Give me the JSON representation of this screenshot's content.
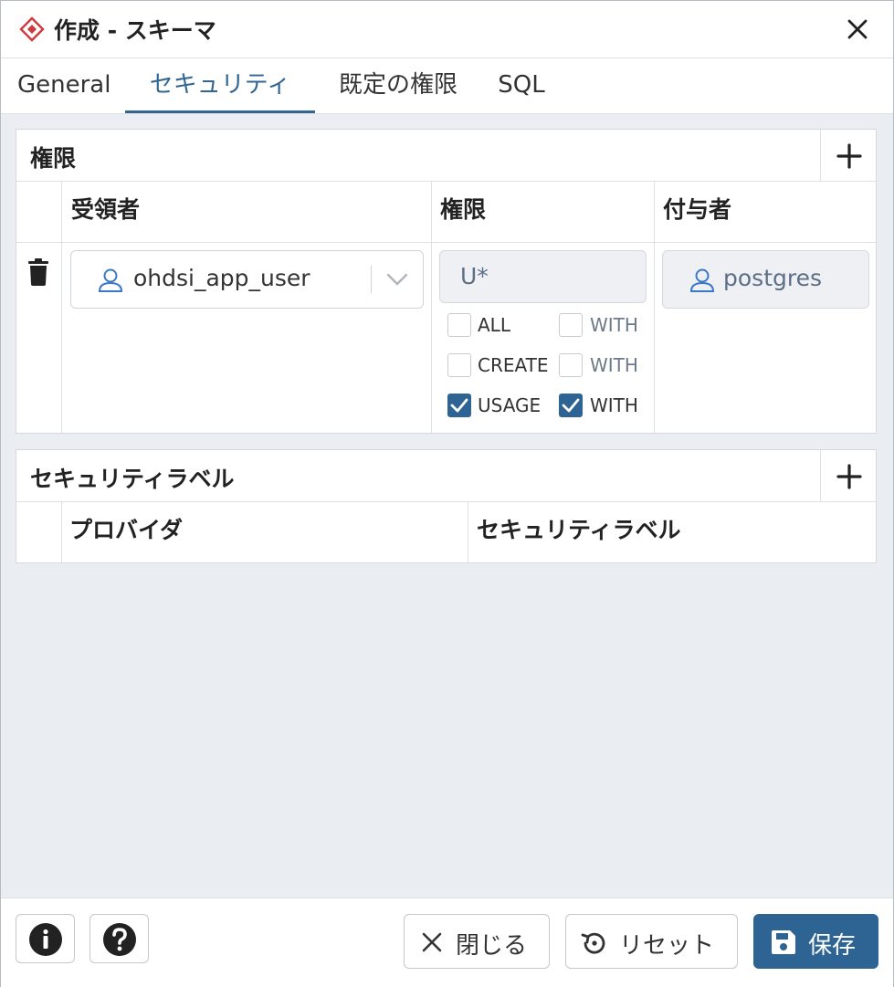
{
  "dialog": {
    "title": "作成 - スキーマ"
  },
  "tabs": [
    {
      "label": "General",
      "active": false
    },
    {
      "label": "セキュリティ",
      "active": true
    },
    {
      "label": "既定の権限",
      "active": false
    },
    {
      "label": "SQL",
      "active": false
    }
  ],
  "privileges_panel": {
    "title": "権限",
    "columns": [
      "受領者",
      "権限",
      "付与者"
    ],
    "row": {
      "grantee": "ohdsi_app_user",
      "privileges_value": "U*",
      "grantor": "postgres",
      "options": [
        {
          "label": "ALL",
          "checked": false,
          "with_label": "WITH",
          "with_checked": false
        },
        {
          "label": "CREATE",
          "checked": false,
          "with_label": "WITH",
          "with_checked": false
        },
        {
          "label": "USAGE",
          "checked": true,
          "with_label": "WITH",
          "with_checked": true
        }
      ]
    }
  },
  "security_labels_panel": {
    "title": "セキュリティラベル",
    "columns": [
      "プロバイダ",
      "セキュリティラベル"
    ]
  },
  "footer": {
    "close_label": "閉じる",
    "reset_label": "リセット",
    "save_label": "保存"
  },
  "colors": {
    "accent": "#326690",
    "primary_button": "#2e6494",
    "title_icon": "#d0393e",
    "user_icon": "#3a78c9"
  }
}
